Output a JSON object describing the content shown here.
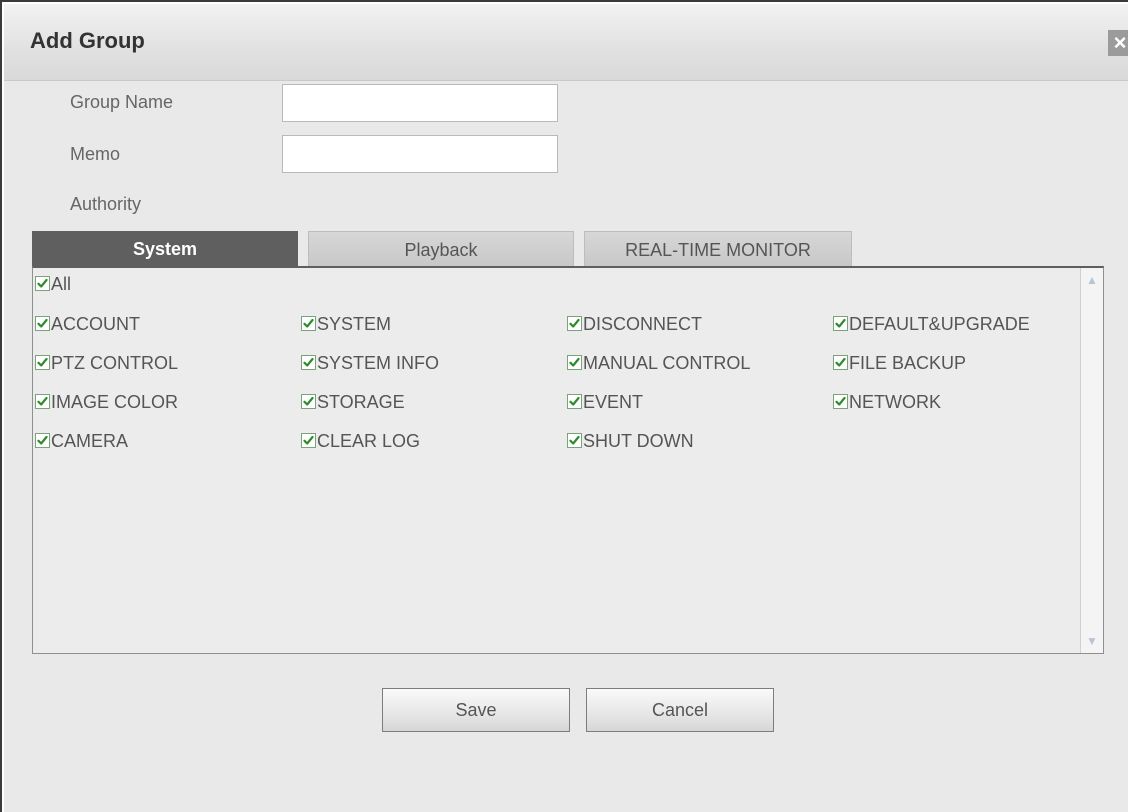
{
  "dialog": {
    "title": "Add Group",
    "close_icon": "close-icon"
  },
  "form": {
    "group_name_label": "Group Name",
    "group_name_value": "",
    "memo_label": "Memo",
    "memo_value": "",
    "authority_label": "Authority"
  },
  "tabs": [
    {
      "label": "System",
      "active": true
    },
    {
      "label": "Playback",
      "active": false
    },
    {
      "label": "REAL-TIME MONITOR",
      "active": false
    }
  ],
  "permissions": {
    "all": {
      "label": "All",
      "checked": true
    },
    "items": [
      {
        "label": "ACCOUNT",
        "checked": true
      },
      {
        "label": "SYSTEM",
        "checked": true
      },
      {
        "label": "DISCONNECT",
        "checked": true
      },
      {
        "label": "DEFAULT&UPGRADE",
        "checked": true
      },
      {
        "label": "PTZ CONTROL",
        "checked": true
      },
      {
        "label": "SYSTEM INFO",
        "checked": true
      },
      {
        "label": "MANUAL CONTROL",
        "checked": true
      },
      {
        "label": "FILE BACKUP",
        "checked": true
      },
      {
        "label": "IMAGE COLOR",
        "checked": true
      },
      {
        "label": "STORAGE",
        "checked": true
      },
      {
        "label": "EVENT",
        "checked": true
      },
      {
        "label": "NETWORK",
        "checked": true
      },
      {
        "label": "CAMERA",
        "checked": true
      },
      {
        "label": "CLEAR LOG",
        "checked": true
      },
      {
        "label": "SHUT DOWN",
        "checked": true
      }
    ]
  },
  "buttons": {
    "save_label": "Save",
    "cancel_label": "Cancel"
  },
  "colors": {
    "active_tab": "#5f5f5f",
    "check_mark": "#2e8b2e"
  }
}
